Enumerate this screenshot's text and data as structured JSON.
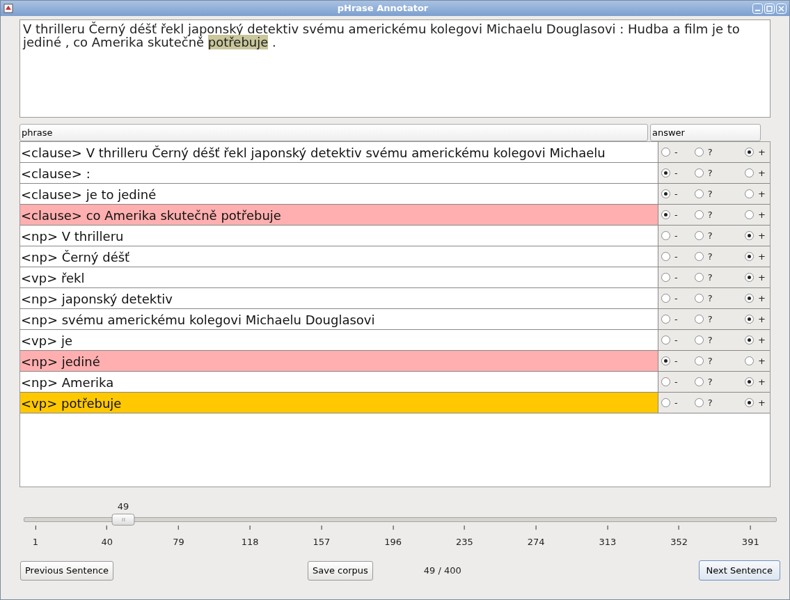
{
  "window": {
    "title": "pHrase Annotator"
  },
  "sentence": [
    {
      "text": "V thrilleru Černý déšť řekl japonský detektiv svému americkému kolegovi Michaelu Douglasovi : Hudba a film je to jediné , co Amerika skutečně ",
      "highlighted": false
    },
    {
      "text": "potřebuje",
      "highlighted": true
    },
    {
      "text": " .",
      "highlighted": false
    }
  ],
  "table": {
    "columns": [
      "phrase",
      "answer"
    ],
    "rows": [
      {
        "phrase": "<clause> V thrilleru Černý déšť řekl japonský detektiv svému americkému kolegovi Michaelu",
        "color": "#ffffff",
        "options": [
          {
            "label": "-",
            "selected": false
          },
          {
            "label": "?",
            "selected": false
          },
          {
            "label": "+",
            "selected": true
          }
        ]
      },
      {
        "phrase": "<clause> :",
        "color": "#ffffff",
        "options": [
          {
            "label": "-",
            "selected": true
          },
          {
            "label": "?",
            "selected": false
          },
          {
            "label": "+",
            "selected": false
          }
        ]
      },
      {
        "phrase": "<clause> je to jediné",
        "color": "#ffffff",
        "options": [
          {
            "label": "-",
            "selected": true
          },
          {
            "label": "?",
            "selected": false
          },
          {
            "label": "+",
            "selected": false
          }
        ]
      },
      {
        "phrase": "<clause> co Amerika skutečně potřebuje",
        "color": "#ffafaf",
        "options": [
          {
            "label": "-",
            "selected": true
          },
          {
            "label": "?",
            "selected": false
          },
          {
            "label": "+",
            "selected": false
          }
        ]
      },
      {
        "phrase": "<np> V thrilleru",
        "color": "#ffffff",
        "options": [
          {
            "label": "-",
            "selected": false
          },
          {
            "label": "?",
            "selected": false
          },
          {
            "label": "+",
            "selected": true
          }
        ]
      },
      {
        "phrase": "<np> Černý déšť",
        "color": "#ffffff",
        "options": [
          {
            "label": "-",
            "selected": false
          },
          {
            "label": "?",
            "selected": false
          },
          {
            "label": "+",
            "selected": true
          }
        ]
      },
      {
        "phrase": "<vp> řekl",
        "color": "#ffffff",
        "options": [
          {
            "label": "-",
            "selected": false
          },
          {
            "label": "?",
            "selected": false
          },
          {
            "label": "+",
            "selected": true
          }
        ]
      },
      {
        "phrase": "<np> japonský detektiv",
        "color": "#ffffff",
        "options": [
          {
            "label": "-",
            "selected": false
          },
          {
            "label": "?",
            "selected": false
          },
          {
            "label": "+",
            "selected": true
          }
        ]
      },
      {
        "phrase": "<np> svému americkému kolegovi Michaelu Douglasovi",
        "color": "#ffffff",
        "options": [
          {
            "label": "-",
            "selected": false
          },
          {
            "label": "?",
            "selected": false
          },
          {
            "label": "+",
            "selected": true
          }
        ]
      },
      {
        "phrase": "<vp> je",
        "color": "#ffffff",
        "options": [
          {
            "label": "-",
            "selected": false
          },
          {
            "label": "?",
            "selected": false
          },
          {
            "label": "+",
            "selected": true
          }
        ]
      },
      {
        "phrase": "<np> jediné",
        "color": "#ffafaf",
        "options": [
          {
            "label": "-",
            "selected": true
          },
          {
            "label": "?",
            "selected": false
          },
          {
            "label": "+",
            "selected": false
          }
        ]
      },
      {
        "phrase": "<np> Amerika",
        "color": "#ffffff",
        "options": [
          {
            "label": "-",
            "selected": false
          },
          {
            "label": "?",
            "selected": false
          },
          {
            "label": "+",
            "selected": true
          }
        ]
      },
      {
        "phrase": "<vp> potřebuje",
        "color": "#ffc800",
        "options": [
          {
            "label": "-",
            "selected": false
          },
          {
            "label": "?",
            "selected": false
          },
          {
            "label": "+",
            "selected": true
          }
        ]
      }
    ]
  },
  "slider": {
    "value": "49",
    "level": 0.12,
    "ticks": [
      "1",
      "40",
      "79",
      "118",
      "157",
      "196",
      "235",
      "274",
      "313",
      "352",
      "391"
    ]
  },
  "buttons": {
    "previous": "Previous Sentence",
    "save": "Save corpus",
    "next": "Next Sentence"
  },
  "counter": "49 / 400"
}
